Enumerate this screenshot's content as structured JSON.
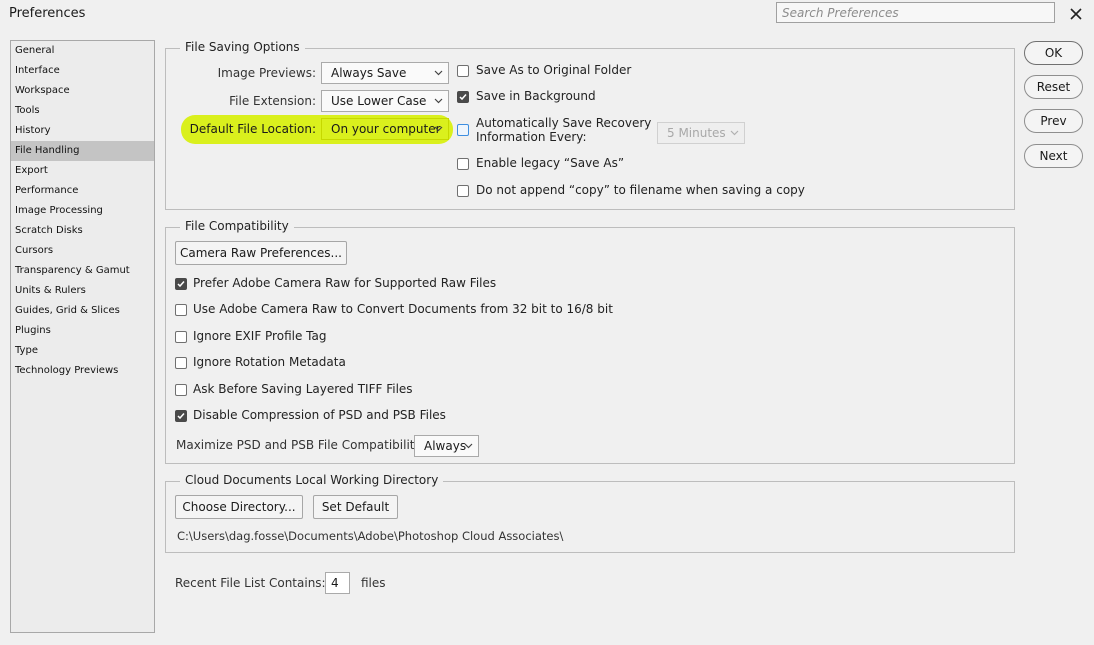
{
  "window": {
    "title": "Preferences",
    "search_placeholder": "Search Preferences",
    "close_icon": "close-icon"
  },
  "sidebar": {
    "items": [
      {
        "label": "General"
      },
      {
        "label": "Interface"
      },
      {
        "label": "Workspace"
      },
      {
        "label": "Tools"
      },
      {
        "label": "History"
      },
      {
        "label": "File Handling",
        "selected": true
      },
      {
        "label": "Export"
      },
      {
        "label": "Performance"
      },
      {
        "label": "Image Processing"
      },
      {
        "label": "Scratch Disks"
      },
      {
        "label": "Cursors"
      },
      {
        "label": "Transparency & Gamut"
      },
      {
        "label": "Units & Rulers"
      },
      {
        "label": "Guides, Grid & Slices"
      },
      {
        "label": "Plugins"
      },
      {
        "label": "Type"
      },
      {
        "label": "Technology Previews"
      }
    ]
  },
  "file_saving": {
    "legend": "File Saving Options",
    "image_previews_label": "Image Previews:",
    "image_previews_value": "Always Save",
    "file_extension_label": "File Extension:",
    "file_extension_value": "Use Lower Case",
    "default_location_label": "Default File Location:",
    "default_location_value": "On your computer",
    "save_as_original": {
      "label": "Save As to Original Folder",
      "checked": false
    },
    "save_in_background": {
      "label": "Save in Background",
      "checked": true
    },
    "auto_save_line1": "Automatically Save Recovery",
    "auto_save_line2": "Information Every:",
    "auto_save_checked": false,
    "auto_save_interval": "5 Minutes",
    "legacy_save_as": {
      "label": "Enable legacy “Save As”",
      "checked": false
    },
    "no_copy": {
      "label": "Do not append “copy” to filename when saving a copy",
      "checked": false
    },
    "highlight_color": "#d7f006"
  },
  "file_compat": {
    "legend": "File Compatibility",
    "camera_raw_button": "Camera Raw Preferences...",
    "prefer_acr": {
      "label": "Prefer Adobe Camera Raw for Supported Raw Files",
      "checked": true
    },
    "use_acr_convert": {
      "label": "Use Adobe Camera Raw to Convert Documents from 32 bit to 16/8 bit",
      "checked": false
    },
    "ignore_exif": {
      "label": "Ignore EXIF Profile Tag",
      "checked": false
    },
    "ignore_rotation": {
      "label": "Ignore Rotation Metadata",
      "checked": false
    },
    "ask_tiff": {
      "label": "Ask Before Saving Layered TIFF Files",
      "checked": false
    },
    "disable_compression": {
      "label": "Disable Compression of PSD and PSB Files",
      "checked": true
    },
    "maximize_label": "Maximize PSD and PSB File Compatibility:",
    "maximize_value": "Always"
  },
  "cloud": {
    "legend": "Cloud Documents Local Working Directory",
    "choose_button": "Choose Directory...",
    "default_button": "Set Default",
    "path": "C:\\Users\\dag.fosse\\Documents\\Adobe\\Photoshop Cloud Associates\\"
  },
  "recent": {
    "label": "Recent File List Contains:",
    "value": "4",
    "suffix": "files"
  },
  "buttons": {
    "ok": "OK",
    "reset": "Reset",
    "prev": "Prev",
    "next": "Next"
  }
}
